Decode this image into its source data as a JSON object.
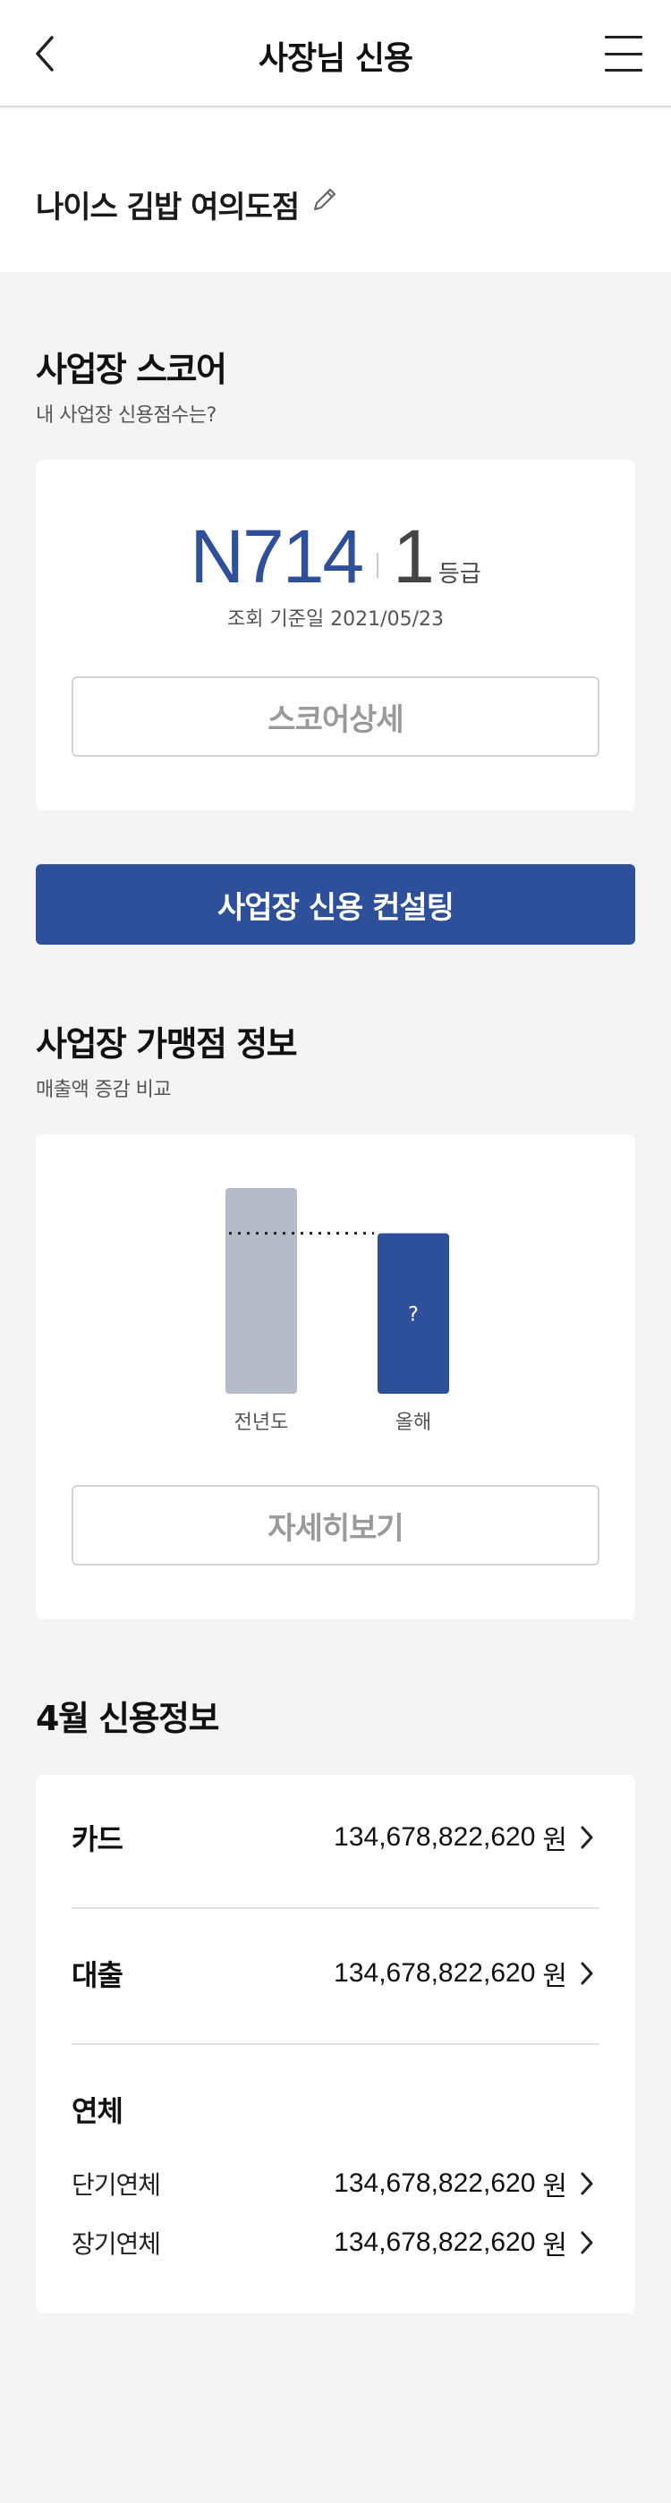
{
  "header": {
    "title": "사장님 신용"
  },
  "store": {
    "name": "나이스 김밥 여의도점"
  },
  "score_section": {
    "title": "사업장 스코어",
    "subtitle": "내 사업장 신용점수는?",
    "score": "N714",
    "grade": "1",
    "grade_unit": "등급",
    "date": "조회 기준일 2021/05/23",
    "detail_button": "스코어상세"
  },
  "consulting_button": "사업장 신용 컨설팅",
  "franchise_section": {
    "title": "사업장 가맹점 정보",
    "subtitle": "매출액 증감 비교",
    "chart_data": {
      "type": "bar",
      "categories": [
        "전년도",
        "올해"
      ],
      "values": [
        1.0,
        0.78
      ],
      "value_labels": [
        "",
        "?"
      ],
      "colors": [
        "#b5bcc8",
        "#2e4f9a"
      ]
    },
    "detail_button": "자세히보기"
  },
  "credit_section": {
    "title": "4월 신용정보",
    "rows": [
      {
        "label": "카드",
        "amount": "134,678,822,620",
        "unit": "원"
      },
      {
        "label": "대출",
        "amount": "134,678,822,620",
        "unit": "원"
      }
    ],
    "overdue": {
      "label": "연체",
      "items": [
        {
          "label": "단기연체",
          "amount": "134,678,822,620",
          "unit": "원"
        },
        {
          "label": "장기연체",
          "amount": "134,678,822,620",
          "unit": "원"
        }
      ]
    }
  }
}
